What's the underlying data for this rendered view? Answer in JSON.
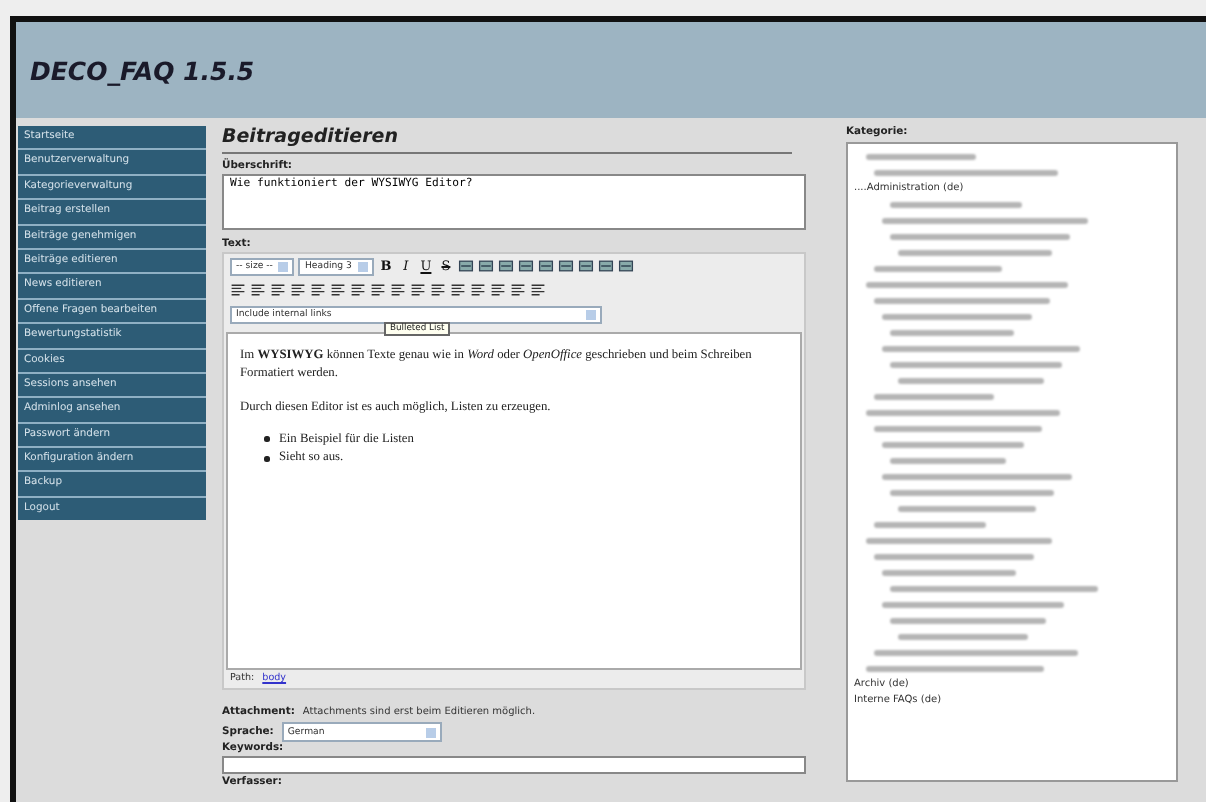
{
  "app": {
    "title": "DECO_FAQ 1.5.5"
  },
  "sidebar": {
    "items": [
      "Startseite",
      "Benutzerverwaltung",
      "Kategorieverwaltung",
      "Beitrag erstellen",
      "Beiträge genehmigen",
      "Beiträge editieren",
      "News editieren",
      "Offene Fragen bearbeiten",
      "Bewertungstatistik",
      "Cookies",
      "Sessions ansehen",
      "Adminlog ansehen",
      "Passwort ändern",
      "Konfiguration ändern",
      "Backup",
      "Logout"
    ]
  },
  "editor_page": {
    "heading": "Beitrageditieren",
    "subject": {
      "label": "Überschrift:",
      "value": "Wie funktioniert der WYSIWYG Editor?"
    },
    "text": {
      "label": "Text:",
      "toolbar": {
        "size_select": "-- size --",
        "format_select": "Heading 3",
        "style_buttons": [
          "B",
          "I",
          "U",
          "S"
        ],
        "links_select": "Include internal links"
      },
      "tooltip": "Bulleted List",
      "content": [
        {
          "kind": "paragraph",
          "text": "Im **WYSIWYG** können Texte genau wie in *Word* oder *OpenOffice* geschrieben und beim Schreiben Formatiert werden."
        },
        {
          "kind": "paragraph",
          "text": "Durch diesen Editor ist es auch möglich, Listen zu erzeugen."
        },
        {
          "kind": "list",
          "items": [
            "Ein Beispiel für die Listen",
            "Sieht so aus."
          ]
        }
      ],
      "path_label": "Path:",
      "path_link": "body"
    },
    "attachment": {
      "label": "Attachment:",
      "text": "Attachments sind erst beim Editieren möglich."
    },
    "language": {
      "label": "Sprache:",
      "value": "German"
    },
    "keywords": {
      "label": "Keywords:"
    },
    "author_label": "Verfasser:"
  },
  "category": {
    "label": "Kategorie:",
    "items": [
      {
        "kind": "redacted"
      },
      {
        "kind": "redacted"
      },
      {
        "kind": "text",
        "text": "....Administration (de)"
      },
      {
        "kind": "redacted"
      },
      {
        "kind": "redacted"
      },
      {
        "kind": "redacted"
      },
      {
        "kind": "redacted"
      },
      {
        "kind": "redacted"
      },
      {
        "kind": "redacted"
      },
      {
        "kind": "redacted"
      },
      {
        "kind": "redacted"
      },
      {
        "kind": "redacted"
      },
      {
        "kind": "redacted"
      },
      {
        "kind": "redacted"
      },
      {
        "kind": "redacted"
      },
      {
        "kind": "redacted"
      },
      {
        "kind": "redacted"
      },
      {
        "kind": "redacted"
      },
      {
        "kind": "redacted"
      },
      {
        "kind": "redacted"
      },
      {
        "kind": "redacted"
      },
      {
        "kind": "redacted"
      },
      {
        "kind": "redacted"
      },
      {
        "kind": "redacted"
      },
      {
        "kind": "redacted"
      },
      {
        "kind": "redacted"
      },
      {
        "kind": "redacted"
      },
      {
        "kind": "redacted"
      },
      {
        "kind": "redacted"
      },
      {
        "kind": "redacted"
      },
      {
        "kind": "redacted"
      },
      {
        "kind": "redacted"
      },
      {
        "kind": "redacted"
      },
      {
        "kind": "text",
        "text": "Archiv (de)"
      },
      {
        "kind": "text",
        "text": "Interne FAQs (de)"
      }
    ]
  }
}
